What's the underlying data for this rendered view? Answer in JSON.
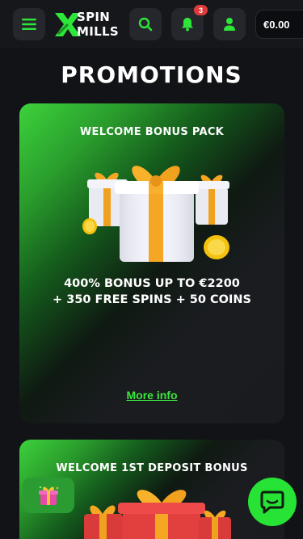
{
  "header": {
    "logo": {
      "line1": "SPIN",
      "line2": "MILLS"
    },
    "notifications_count": "3",
    "balance": "€0.00",
    "icons": [
      "hamburger-menu-icon",
      "search-icon",
      "bell-icon",
      "user-icon"
    ],
    "accent_color": "#2ee53a"
  },
  "page": {
    "title": "PROMOTIONS"
  },
  "promotions": [
    {
      "title": "WELCOME BONUS PACK",
      "offer_line1": "400% BONUS UP TO €2200",
      "offer_line2": "+ 350 FREE SPINS + 50 COINS",
      "link": "More info",
      "image": "gift-boxes-coins"
    },
    {
      "title": "WELCOME 1ST DEPOSIT BONUS",
      "image": "gift-boxes-red"
    }
  ],
  "floating": {
    "gift_button_icon": "gift-icon",
    "chat_button_icon": "chat-icon"
  }
}
